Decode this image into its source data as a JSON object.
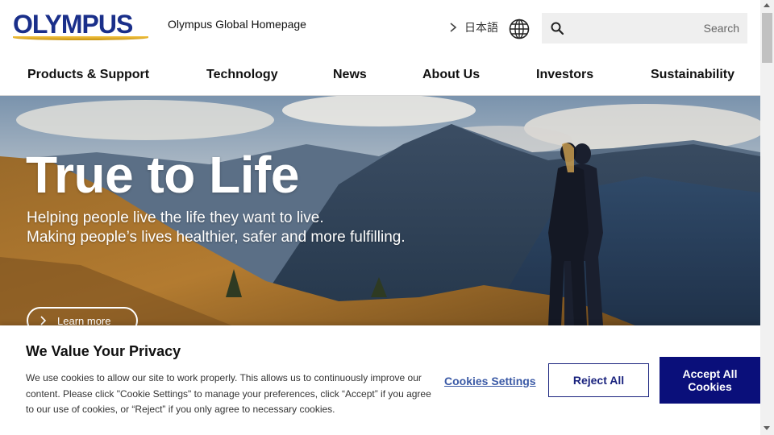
{
  "header": {
    "logo_text": "OLYMPUS",
    "global_home_label": "Olympus Global Homepage",
    "language_label": "日本語",
    "search_placeholder": "Search"
  },
  "nav": {
    "items": [
      "Products & Support",
      "Technology",
      "News",
      "About Us",
      "Investors",
      "Sustainability"
    ]
  },
  "hero": {
    "title": "True to Life",
    "subtitle_line1": "Helping people live the life they want to live.",
    "subtitle_line2": "Making people’s lives healthier, safer and more fulfilling.",
    "cta_label": "Learn more"
  },
  "privacy": {
    "title": "We Value Your Privacy",
    "body": "We use cookies to allow our site to work properly. This allows us to continuously improve our content. Please click \"Cookie Settings\" to manage your preferences, click “Accept” if you agree to our use of cookies, or “Reject” if you only agree to necessary cookies.",
    "settings_label": "Cookies Settings",
    "reject_label": "Reject All",
    "accept_label": "Accept All Cookies"
  },
  "colors": {
    "brand_blue": "#1a2f8a",
    "brand_gold": "#f3c340",
    "accept_bg": "#0a0f7a",
    "link_blue": "#3b5aa6"
  }
}
